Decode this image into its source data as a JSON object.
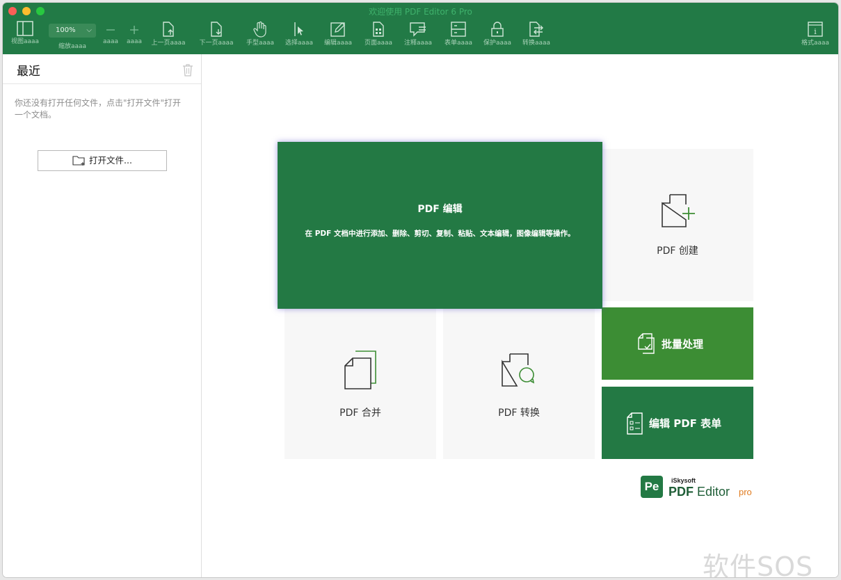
{
  "window": {
    "title": "欢迎使用 PDF Editor 6 Pro"
  },
  "toolbar": {
    "zoom_value": "100%",
    "items": [
      {
        "icon": "view-icon",
        "label": "视图aaaa"
      },
      {
        "icon": "zoom-select",
        "label": "缩放aaaa"
      },
      {
        "icon": "zoom-out-icon",
        "label": "aaaa"
      },
      {
        "icon": "zoom-in-icon",
        "label": "aaaa"
      },
      {
        "icon": "prev-page-icon",
        "label": "上一页aaaa"
      },
      {
        "icon": "next-page-icon",
        "label": "下一页aaaa"
      },
      {
        "icon": "hand-icon",
        "label": "手型aaaa"
      },
      {
        "icon": "select-icon",
        "label": "选择aaaa"
      },
      {
        "icon": "edit-icon",
        "label": "编辑aaaa"
      },
      {
        "icon": "page-icon",
        "label": "页面aaaa"
      },
      {
        "icon": "comment-icon",
        "label": "注释aaaa"
      },
      {
        "icon": "form-icon",
        "label": "表单aaaa"
      },
      {
        "icon": "lock-icon",
        "label": "保护aaaa"
      },
      {
        "icon": "convert-icon",
        "label": "转换aaaa"
      },
      {
        "icon": "info-icon",
        "label": "格式aaaa"
      }
    ]
  },
  "sidebar": {
    "title": "最近",
    "empty_message": "你还没有打开任何文件，点击\"打开文件\"打开一个文档。",
    "open_button": "打开文件..."
  },
  "tiles": {
    "edit": {
      "title": "PDF 编辑",
      "description": "在 PDF 文档中进行添加、删除、剪切、复制、粘贴、文本编辑，图像编辑等操作。"
    },
    "create": {
      "label": "PDF 创建"
    },
    "merge": {
      "label": "PDF 合并"
    },
    "convert": {
      "label": "PDF 转换"
    },
    "batch": {
      "label": "批量处理"
    },
    "form": {
      "label": "编辑 PDF 表单"
    }
  },
  "logo": {
    "mark": "Pe",
    "brand": "iSkysoft",
    "name_bold": "PDF",
    "name_rest": " Editor",
    "edition": "pro"
  },
  "watermark": "软件SOS",
  "colors": {
    "brand_green": "#237944",
    "batch_green": "#3c8d34",
    "pro_orange": "#e07b1f",
    "toolbar_green": "#227a46"
  }
}
